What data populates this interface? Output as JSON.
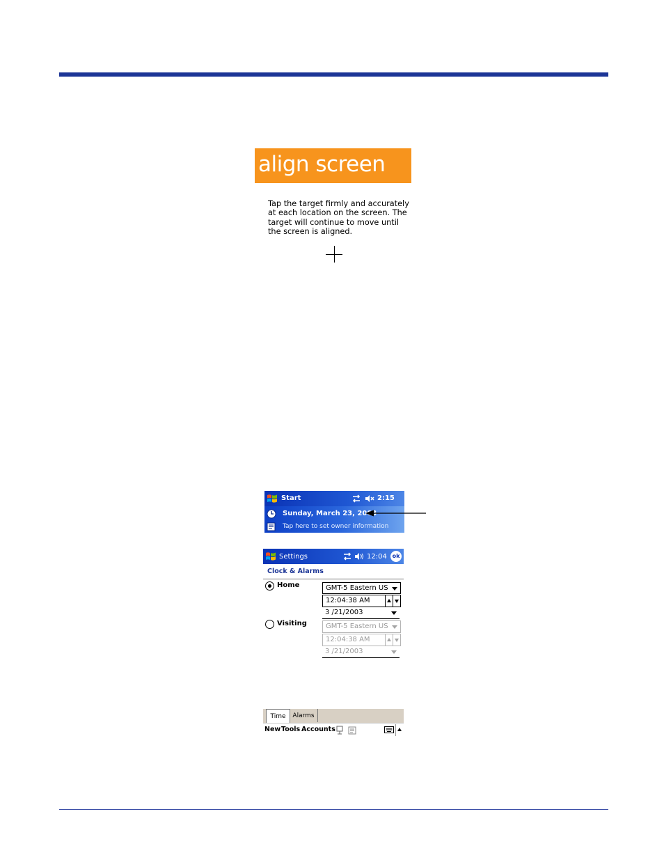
{
  "align_screen": {
    "title": "align screen",
    "instructions": [
      "Tap the target firmly and accurately",
      "at each location on the screen. The",
      "target will continue to move until",
      "the screen is aligned."
    ]
  },
  "today_screen": {
    "start_label": "Start",
    "time": "2:15",
    "date": "Sunday, March 23, 2003",
    "owner_prompt": "Tap here to set owner information"
  },
  "settings_screen": {
    "title": "Settings",
    "time": "12:04",
    "ok_label": "ok",
    "subtitle": "Clock & Alarms",
    "home": {
      "label": "Home",
      "selected": true,
      "timezone": "GMT-5 Eastern US",
      "time": "12:04:38 AM",
      "date": "3 /21/2003"
    },
    "visiting": {
      "label": "Visiting",
      "selected": false,
      "timezone": "GMT-5 Eastern US",
      "time": "12:04:38 AM",
      "date": "3 /21/2003"
    }
  },
  "tabs": [
    "Time",
    "Alarms"
  ],
  "menubar": {
    "items": [
      "New",
      "Tools",
      "Accounts"
    ]
  },
  "colors": {
    "rule": "#1c3596",
    "banner": "#f7941d",
    "titlebar": "#1f57d3"
  }
}
